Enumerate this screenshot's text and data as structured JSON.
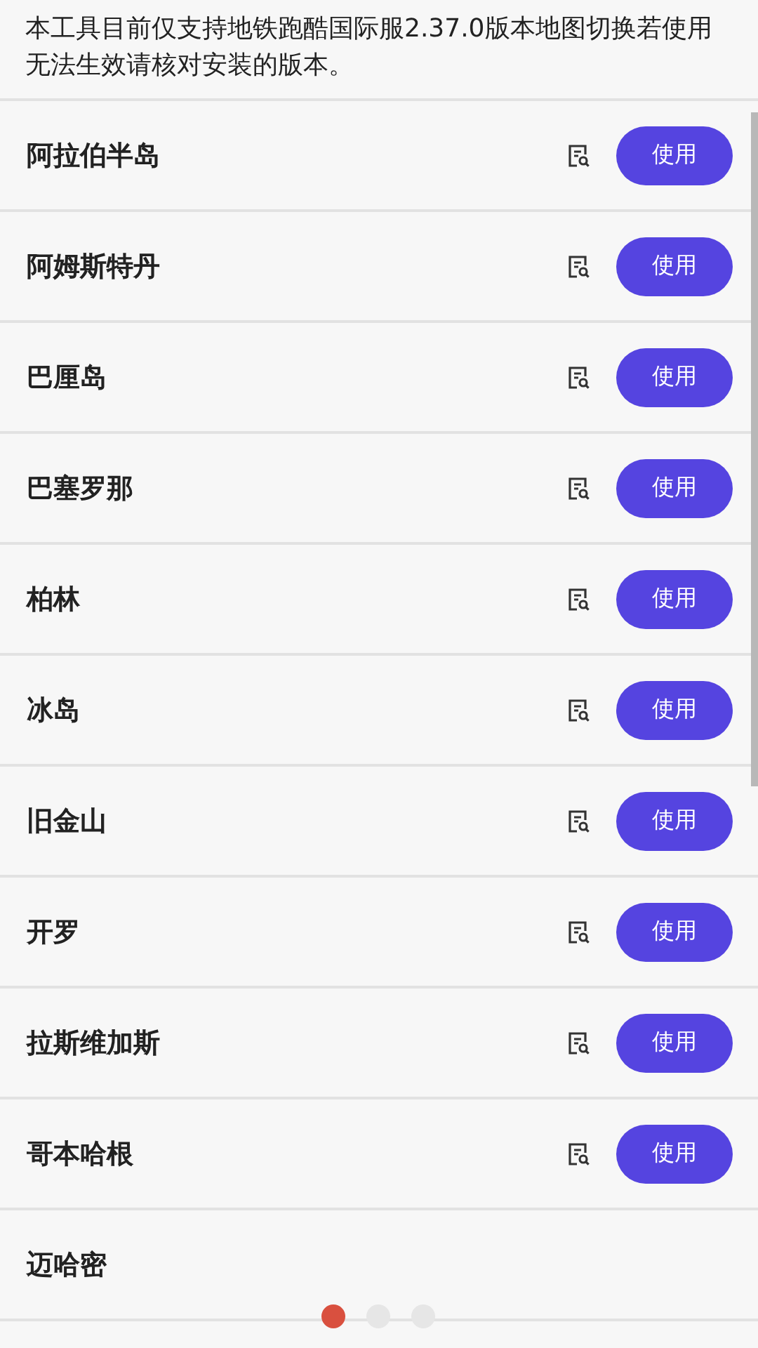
{
  "notice": "本工具目前仅支持地铁跑酷国际服2.37.0版本地图切换若使用无法生效请核对安装的版本。",
  "maps": [
    {
      "name": "阿拉伯半岛",
      "button": "使用"
    },
    {
      "name": "阿姆斯特丹",
      "button": "使用"
    },
    {
      "name": "巴厘岛",
      "button": "使用"
    },
    {
      "name": "巴塞罗那",
      "button": "使用"
    },
    {
      "name": "柏林",
      "button": "使用"
    },
    {
      "name": "冰岛",
      "button": "使用"
    },
    {
      "name": "旧金山",
      "button": "使用"
    },
    {
      "name": "开罗",
      "button": "使用"
    },
    {
      "name": "拉斯维加斯",
      "button": "使用"
    },
    {
      "name": "哥本哈根",
      "button": "使用"
    },
    {
      "name": "迈哈密"
    }
  ],
  "pager": [
    {
      "selected": true
    },
    {
      "selected": false
    },
    {
      "selected": false
    }
  ]
}
